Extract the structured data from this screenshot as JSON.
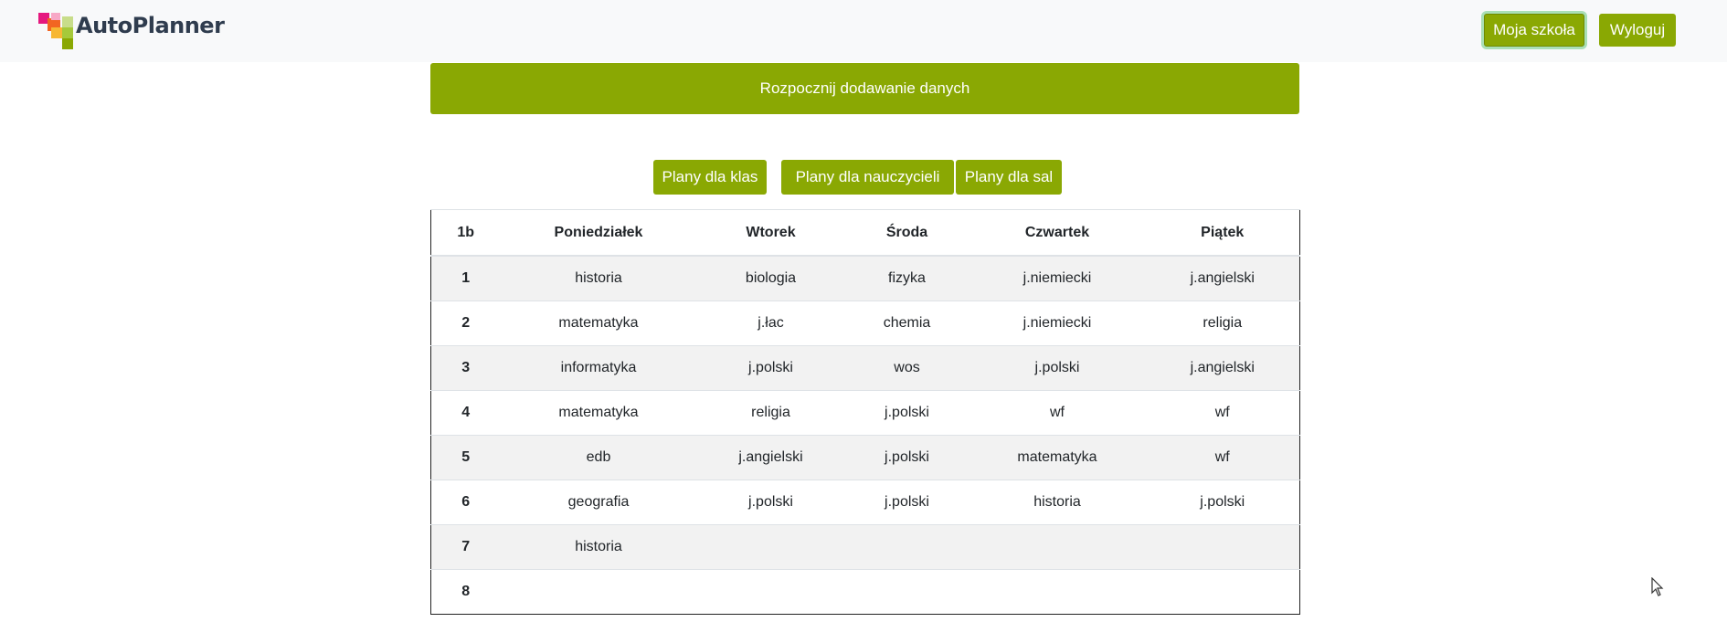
{
  "header": {
    "logo_text": "AutoPlanner",
    "buttons": [
      {
        "label": "Moja szkoła",
        "active": true
      },
      {
        "label": "Wyloguj",
        "active": false
      }
    ]
  },
  "banner": {
    "label": "Rozpocznij dodawanie danych"
  },
  "plan_buttons": [
    "Plany dla klas",
    "Plany dla nauczycieli",
    "Plany dla sal"
  ],
  "table": {
    "class_name": "1b",
    "days": [
      "Poniedziałek",
      "Wtorek",
      "Środa",
      "Czwartek",
      "Piątek"
    ],
    "rows": [
      {
        "lesson": "1",
        "cells": [
          "historia",
          "biologia",
          "fizyka",
          "j.niemiecki",
          "j.angielski"
        ]
      },
      {
        "lesson": "2",
        "cells": [
          "matematyka",
          "j.łac",
          "chemia",
          "j.niemiecki",
          "religia"
        ]
      },
      {
        "lesson": "3",
        "cells": [
          "informatyka",
          "j.polski",
          "wos",
          "j.polski",
          "j.angielski"
        ]
      },
      {
        "lesson": "4",
        "cells": [
          "matematyka",
          "religia",
          "j.polski",
          "wf",
          "wf"
        ]
      },
      {
        "lesson": "5",
        "cells": [
          "edb",
          "j.angielski",
          "j.polski",
          "matematyka",
          "wf"
        ]
      },
      {
        "lesson": "6",
        "cells": [
          "geografia",
          "j.polski",
          "j.polski",
          "historia",
          "j.polski"
        ]
      },
      {
        "lesson": "7",
        "cells": [
          "historia",
          "",
          "",
          "",
          ""
        ]
      },
      {
        "lesson": "8",
        "cells": [
          "",
          "",
          "",
          "",
          ""
        ]
      }
    ]
  },
  "colors": {
    "accent": "#8aa803",
    "navbar_bg": "#f8f9fa",
    "stripe": "#f2f2f2"
  }
}
